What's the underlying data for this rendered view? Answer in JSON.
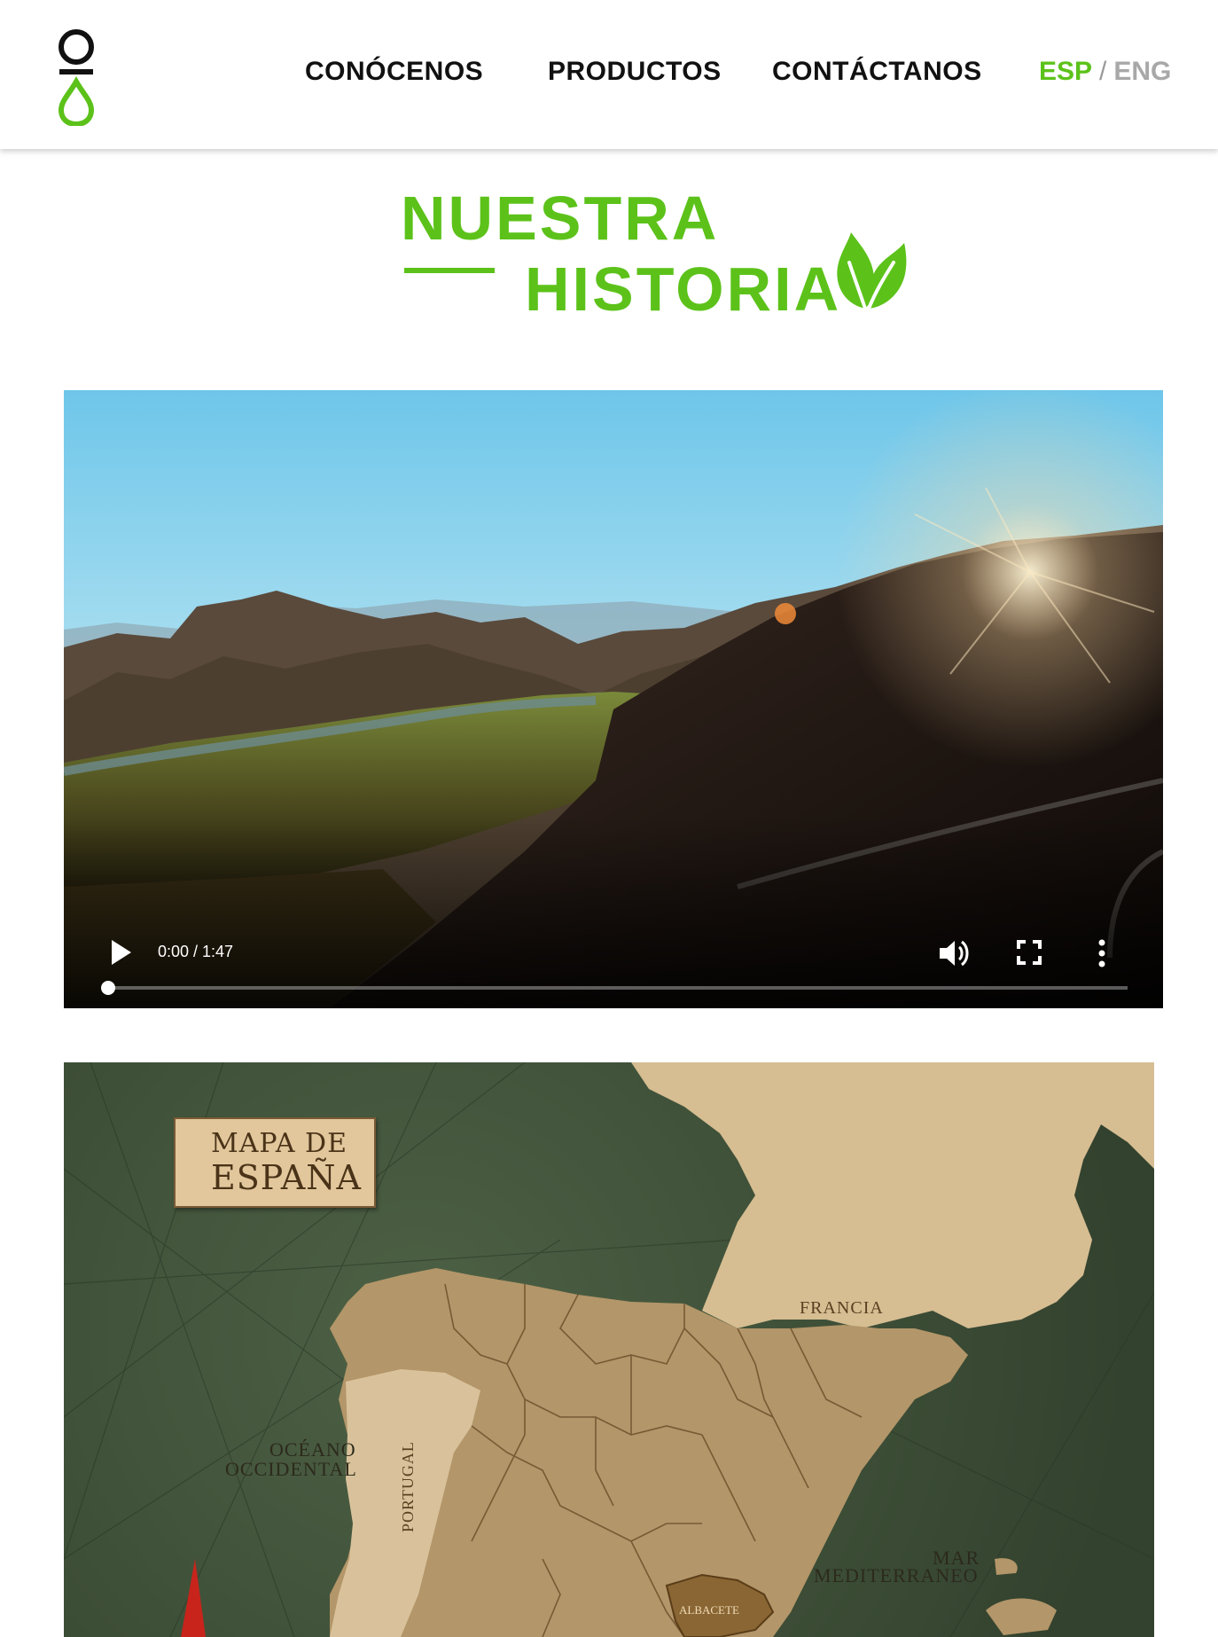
{
  "nav": {
    "items": [
      {
        "label": "CONÓCENOS"
      },
      {
        "label": "PRODUCTOS"
      },
      {
        "label": "CONTÁCTANOS"
      }
    ],
    "lang_active": "ESP",
    "lang_separator": "/",
    "lang_inactive": "ENG"
  },
  "hero": {
    "title_line1": "NUESTRA",
    "title_line2": "HISTORIA"
  },
  "video": {
    "time_display": "0:00 / 1:47",
    "progress": 0
  },
  "map": {
    "plaque_line1": "MAPA DE",
    "plaque_line2": "ESPAÑA",
    "label_francia": "FRANCIA",
    "label_oceano_line1": "OCÉANO",
    "label_oceano_line2": "OCCIDENTAL",
    "label_portugal": "PORTUGAL",
    "label_mar_line1": "MAR",
    "label_mar_line2": "MEDITERRANEO",
    "label_albacete": "ALBACETE"
  },
  "colors": {
    "brand_green": "#5cc21a",
    "nav_text": "#111111",
    "lang_inactive": "#a8a8a8",
    "map_sea": "#3f5239",
    "map_land": "#c9ad80"
  },
  "icons": {
    "logo": "oil-drop-logo",
    "leaf": "leaf-icon",
    "play": "play-icon",
    "volume": "volume-icon",
    "fullscreen": "fullscreen-icon",
    "more": "more-vertical-icon"
  }
}
